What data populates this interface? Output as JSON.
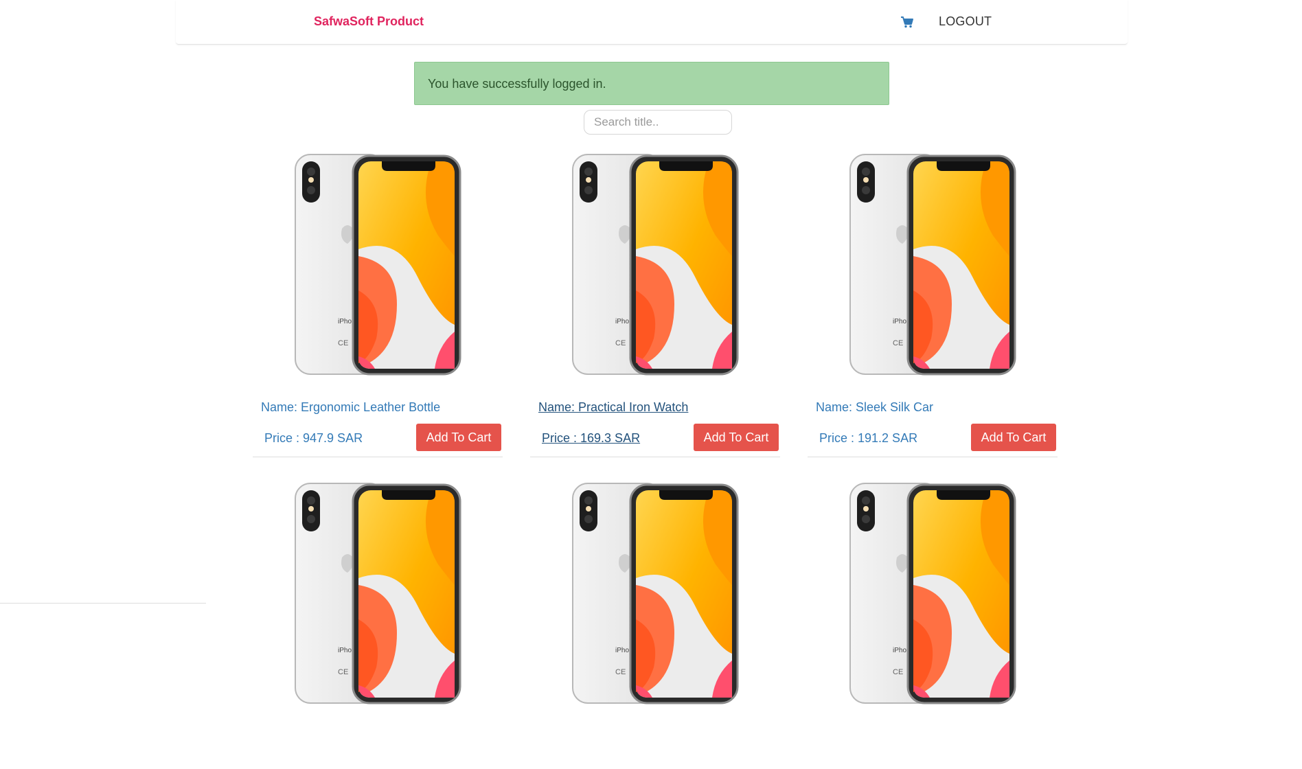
{
  "header": {
    "brand": "SafwaSoft Product",
    "cart_icon": "shopping-cart-icon",
    "logout_label": "LOGOUT"
  },
  "alert": {
    "message": "You have successfully logged in.",
    "color": "#a5d6a7"
  },
  "search": {
    "placeholder": "Search title..",
    "value": ""
  },
  "products": [
    {
      "name": "Name: Ergonomic Leather Bottle",
      "price": "Price : 947.9 SAR",
      "button": "Add To Cart"
    },
    {
      "name": "Name: Practical Iron Watch",
      "price": "Price : 169.3 SAR",
      "button": "Add To Cart"
    },
    {
      "name": "Name: Sleek Silk Car",
      "price": "Price : 191.2 SAR",
      "button": "Add To Cart"
    }
  ],
  "colors": {
    "brand": "#e0245e",
    "link": "#337ab7",
    "button": "#e5534b",
    "alert_text": "#2b542c"
  }
}
